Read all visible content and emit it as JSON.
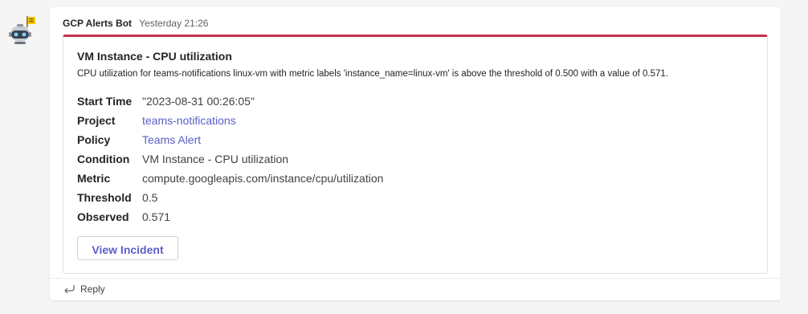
{
  "message": {
    "sender": "GCP Alerts Bot",
    "timestamp": "Yesterday 21:26"
  },
  "card": {
    "accent_color": "#c4314b",
    "title": "VM Instance - CPU utilization",
    "description": "CPU utilization for teams-notifications linux-vm with metric labels 'instance_name=linux-vm' is above the threshold of 0.500 with a value of 0.571.",
    "facts": [
      {
        "key": "Start Time",
        "value": "\"2023-08-31 00:26:05\""
      },
      {
        "key": "Project",
        "value": "teams-notifications"
      },
      {
        "key": "Policy",
        "value": "Teams Alert"
      },
      {
        "key": "Condition",
        "value": "VM Instance - CPU utilization"
      },
      {
        "key": "Metric",
        "value": "compute.googleapis.com/instance/cpu/utilization"
      },
      {
        "key": "Threshold",
        "value": "0.5"
      },
      {
        "key": "Observed",
        "value": "0.571"
      }
    ],
    "action_label": "View Incident"
  },
  "reply_label": "Reply",
  "icons": {
    "avatar": "robot-bot-icon",
    "reply": "reply-arrow-icon"
  },
  "colors": {
    "link": "#5b5fc7",
    "alert_bar": "#c4314b"
  }
}
